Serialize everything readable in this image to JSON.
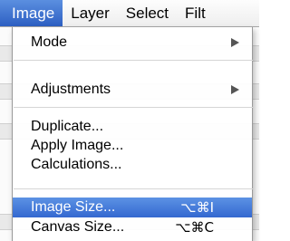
{
  "menubar": {
    "items": [
      "Image",
      "Layer",
      "Select",
      "Filt"
    ],
    "active_index": 0
  },
  "image_menu": {
    "mode": {
      "label": "Mode"
    },
    "adjustments": {
      "label": "Adjustments"
    },
    "duplicate": {
      "label": "Duplicate..."
    },
    "apply_image": {
      "label": "Apply Image..."
    },
    "calculations": {
      "label": "Calculations..."
    },
    "image_size": {
      "label": "Image Size...",
      "shortcut": "⌥⌘I"
    },
    "canvas_size": {
      "label": "Canvas Size...",
      "shortcut": "⌥⌘C"
    }
  },
  "colors": {
    "highlight": "#3468d0",
    "menubar_bg": "#eeeeee"
  }
}
